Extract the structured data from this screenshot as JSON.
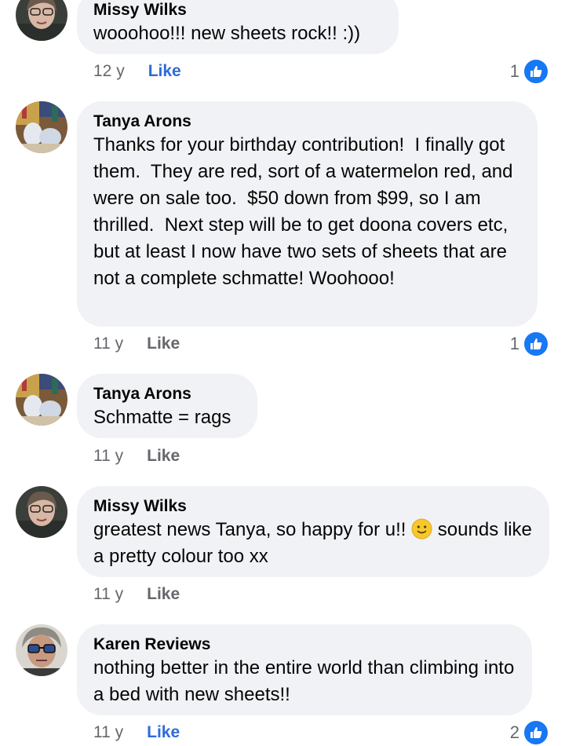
{
  "comments": [
    {
      "author": "Missy Wilks",
      "avatar": "woman-with-glasses-avatar",
      "text": "wooohoo!!! new sheets rock!! :))",
      "time": "12 y",
      "like_label": "Like",
      "like_active": true,
      "reaction_count": "1"
    },
    {
      "author": "Tanya Arons",
      "avatar": "toys-shelf-avatar",
      "text": "Thanks for your birthday contribution!  I finally got them.  They are red, sort of a watermelon red, and were on sale too.  $50 down from $99, so I am thrilled.  Next step will be to get doona covers etc, but at least I now have two sets of sheets that are not a complete schmatte! Woohooo!",
      "time": "11 y",
      "like_label": "Like",
      "like_active": false,
      "reaction_count": "1"
    },
    {
      "author": "Tanya Arons",
      "avatar": "toys-shelf-avatar",
      "text": "Schmatte = rags",
      "time": "11 y",
      "like_label": "Like",
      "like_active": false
    },
    {
      "author": "Missy Wilks",
      "avatar": "woman-with-glasses-avatar",
      "text_before_emoji": "greatest news Tanya, so happy for u!! ",
      "emoji": "slightly-smiling-face-emoji",
      "text_after_emoji": " sounds like a pretty colour too xx",
      "time": "11 y",
      "like_label": "Like",
      "like_active": false
    },
    {
      "author": "Karen Reviews",
      "avatar": "person-with-blue-glasses-avatar",
      "text": "nothing better in the entire world than climbing into a bed with new sheets!!",
      "time": "11 y",
      "like_label": "Like",
      "like_active": true,
      "reaction_count": "2"
    }
  ],
  "colors": {
    "bubble": "#f0f2f5",
    "like_active": "#2e6bd9",
    "meta_grey": "#65676b",
    "reaction_blue": "#1877f2"
  },
  "reaction_icon": "thumbs-up-icon"
}
